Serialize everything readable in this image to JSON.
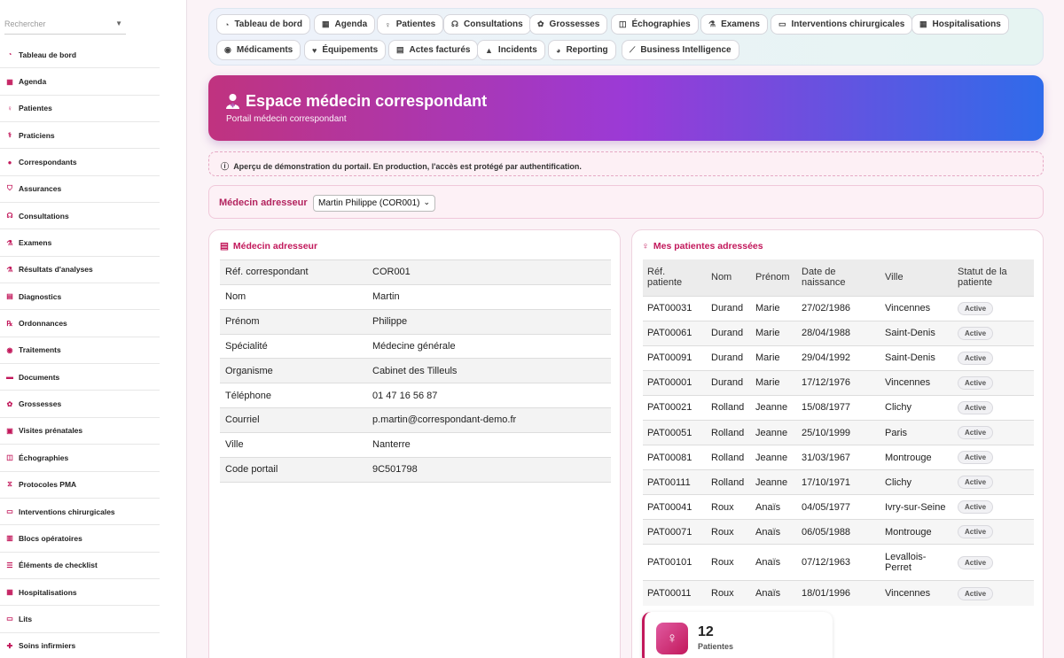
{
  "sidebar": {
    "search_placeholder": "Rechercher",
    "items": [
      {
        "label": "Tableau de bord",
        "icon": "gauge-icon"
      },
      {
        "label": "Agenda",
        "icon": "calendar-icon"
      },
      {
        "label": "Patientes",
        "icon": "venus-icon"
      },
      {
        "label": "Praticiens",
        "icon": "user-doctor-icon"
      },
      {
        "label": "Correspondants",
        "icon": "user-icon"
      },
      {
        "label": "Assurances",
        "icon": "shield-icon"
      },
      {
        "label": "Consultations",
        "icon": "stethoscope-icon"
      },
      {
        "label": "Examens",
        "icon": "microscope-icon"
      },
      {
        "label": "Résultats d'analyses",
        "icon": "flask-icon"
      },
      {
        "label": "Diagnostics",
        "icon": "file-medical-icon"
      },
      {
        "label": "Ordonnances",
        "icon": "prescription-icon"
      },
      {
        "label": "Traitements",
        "icon": "pills-icon"
      },
      {
        "label": "Documents",
        "icon": "document-icon"
      },
      {
        "label": "Grossesses",
        "icon": "baby-icon"
      },
      {
        "label": "Visites prénatales",
        "icon": "clipboard-icon"
      },
      {
        "label": "Échographies",
        "icon": "ultrasound-icon"
      },
      {
        "label": "Protocoles PMA",
        "icon": "dna-icon"
      },
      {
        "label": "Interventions chirurgicales",
        "icon": "bed-icon"
      },
      {
        "label": "Blocs opératoires",
        "icon": "hospital-icon"
      },
      {
        "label": "Éléments de checklist",
        "icon": "checklist-icon"
      },
      {
        "label": "Hospitalisations",
        "icon": "hospital-user-icon"
      },
      {
        "label": "Lits",
        "icon": "bed-icon"
      },
      {
        "label": "Soins infirmiers",
        "icon": "nurse-icon"
      }
    ]
  },
  "topnav": {
    "items": [
      {
        "label": "Tableau de bord",
        "icon": "gauge-icon"
      },
      {
        "label": "Agenda",
        "icon": "calendar-icon"
      },
      {
        "label": "Patientes",
        "icon": "venus-icon"
      },
      {
        "label": "Consultations",
        "icon": "stethoscope-icon"
      },
      {
        "label": "Grossesses",
        "icon": "baby-icon"
      },
      {
        "label": "Échographies",
        "icon": "ultrasound-icon"
      },
      {
        "label": "Examens",
        "icon": "microscope-icon"
      },
      {
        "label": "Interventions chirurgicales",
        "icon": "bed-icon"
      },
      {
        "label": "Hospitalisations",
        "icon": "hospital-user-icon"
      },
      {
        "label": "Médicaments",
        "icon": "pills-icon"
      },
      {
        "label": "Équipements",
        "icon": "heart-pulse-icon"
      },
      {
        "label": "Actes facturés",
        "icon": "receipt-icon"
      },
      {
        "label": "Incidents",
        "icon": "warning-icon"
      },
      {
        "label": "Reporting",
        "icon": "pie-chart-icon"
      },
      {
        "label": "Business Intelligence",
        "icon": "line-chart-icon"
      }
    ]
  },
  "hero": {
    "title": "Espace médecin correspondant",
    "subtitle": "Portail médecin correspondant",
    "icon": "user-doctor-icon"
  },
  "alert": {
    "text": "Aperçu de démonstration du portail. En production, l'accès est protégé par authentification.",
    "icon": "info-icon"
  },
  "selector": {
    "label": "Médecin adresseur",
    "value": "Martin Philippe (COR001)"
  },
  "doctor_card": {
    "title": "Médecin adresseur",
    "icon": "id-card-icon",
    "rows": [
      {
        "key": "Réf. correspondant",
        "value": "COR001"
      },
      {
        "key": "Nom",
        "value": "Martin"
      },
      {
        "key": "Prénom",
        "value": "Philippe"
      },
      {
        "key": "Spécialité",
        "value": "Médecine générale"
      },
      {
        "key": "Organisme",
        "value": "Cabinet des Tilleuls"
      },
      {
        "key": "Téléphone",
        "value": "01 47 16 56 87"
      },
      {
        "key": "Courriel",
        "value": "p.martin@correspondant-demo.fr"
      },
      {
        "key": "Ville",
        "value": "Nanterre"
      },
      {
        "key": "Code portail",
        "value": "9C501798"
      }
    ]
  },
  "patients_card": {
    "title": "Mes patientes adressées",
    "icon": "venus-icon",
    "columns": [
      "Réf. patiente",
      "Nom",
      "Prénom",
      "Date de naissance",
      "Ville",
      "Statut de la patiente"
    ],
    "rows": [
      {
        "ref": "PAT00031",
        "nom": "Durand",
        "prenom": "Marie",
        "naissance": "27/02/1986",
        "ville": "Vincennes",
        "statut": "Active"
      },
      {
        "ref": "PAT00061",
        "nom": "Durand",
        "prenom": "Marie",
        "naissance": "28/04/1988",
        "ville": "Saint-Denis",
        "statut": "Active"
      },
      {
        "ref": "PAT00091",
        "nom": "Durand",
        "prenom": "Marie",
        "naissance": "29/04/1992",
        "ville": "Saint-Denis",
        "statut": "Active"
      },
      {
        "ref": "PAT00001",
        "nom": "Durand",
        "prenom": "Marie",
        "naissance": "17/12/1976",
        "ville": "Vincennes",
        "statut": "Active"
      },
      {
        "ref": "PAT00021",
        "nom": "Rolland",
        "prenom": "Jeanne",
        "naissance": "15/08/1977",
        "ville": "Clichy",
        "statut": "Active"
      },
      {
        "ref": "PAT00051",
        "nom": "Rolland",
        "prenom": "Jeanne",
        "naissance": "25/10/1999",
        "ville": "Paris",
        "statut": "Active"
      },
      {
        "ref": "PAT00081",
        "nom": "Rolland",
        "prenom": "Jeanne",
        "naissance": "31/03/1967",
        "ville": "Montrouge",
        "statut": "Active"
      },
      {
        "ref": "PAT00111",
        "nom": "Rolland",
        "prenom": "Jeanne",
        "naissance": "17/10/1971",
        "ville": "Clichy",
        "statut": "Active"
      },
      {
        "ref": "PAT00041",
        "nom": "Roux",
        "prenom": "Anaïs",
        "naissance": "04/05/1977",
        "ville": "Ivry-sur-Seine",
        "statut": "Active"
      },
      {
        "ref": "PAT00071",
        "nom": "Roux",
        "prenom": "Anaïs",
        "naissance": "06/05/1988",
        "ville": "Montrouge",
        "statut": "Active"
      },
      {
        "ref": "PAT00101",
        "nom": "Roux",
        "prenom": "Anaïs",
        "naissance": "07/12/1963",
        "ville": "Levallois-Perret",
        "statut": "Active"
      },
      {
        "ref": "PAT00011",
        "nom": "Roux",
        "prenom": "Anaïs",
        "naissance": "18/01/1996",
        "ville": "Vincennes",
        "statut": "Active"
      }
    ]
  },
  "stat": {
    "value": "12",
    "label": "Patientes",
    "icon": "venus-icon"
  },
  "colors": {
    "accent": "#c2185b",
    "hero_start": "#c0337f",
    "hero_mid": "#9b3ad6",
    "hero_end": "#2f6bea"
  }
}
